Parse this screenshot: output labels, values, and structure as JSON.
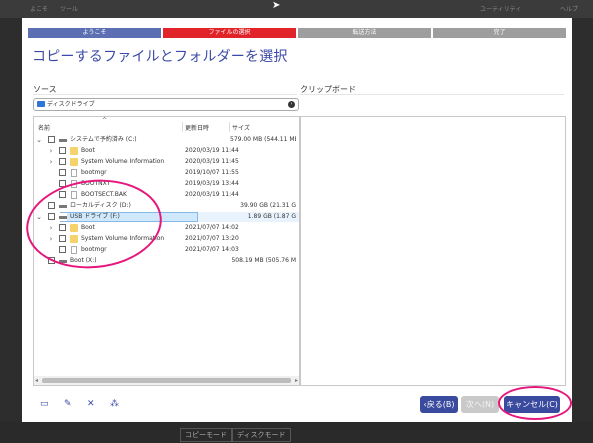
{
  "background": {
    "top_items": [
      "よこそ",
      "ツール",
      "ユーティリティ",
      "ヘルプ"
    ],
    "bottom_tabs": [
      "コピーモード",
      "ディスクモード"
    ]
  },
  "steps": [
    {
      "label": "ようこそ"
    },
    {
      "label": "ファイルの選択"
    },
    {
      "label": "転送方法"
    },
    {
      "label": "完了"
    }
  ],
  "title": "コピーするファイルとフォルダーを選択",
  "source": {
    "label": "ソース",
    "location": "ディスクドライブ"
  },
  "clipboard_label": "クリップボード",
  "tree": {
    "columns": {
      "name": "名前",
      "date": "更新日時",
      "size": "サイズ"
    },
    "rows": [
      {
        "name": "システムで予約済み (C:)",
        "date": "",
        "size": "579.00 MB (544.11 MB"
      },
      {
        "name": "Boot",
        "date": "2020/03/19 11:44",
        "size": ""
      },
      {
        "name": "System Volume Information",
        "date": "2020/03/19 11:45",
        "size": ""
      },
      {
        "name": "bootmgr",
        "date": "2019/10/07 11:55",
        "size": ""
      },
      {
        "name": "BOOTNXT",
        "date": "2019/03/19 13:44",
        "size": ""
      },
      {
        "name": "BOOTSECT.BAK",
        "date": "2020/03/19 11:44",
        "size": ""
      },
      {
        "name": "ローカルディスク (D:)",
        "date": "",
        "size": "39.90 GB (21.31 G"
      },
      {
        "name": "USB ドライブ (F:)",
        "date": "",
        "size": "1.89 GB (1.87 G"
      },
      {
        "name": "Boot",
        "date": "2021/07/07 14:02",
        "size": ""
      },
      {
        "name": "System Volume Information",
        "date": "2021/07/07 13:20",
        "size": ""
      },
      {
        "name": "bootmgr",
        "date": "2021/07/07 14:03",
        "size": ""
      },
      {
        "name": "Boot (X:)",
        "date": "",
        "size": "508.19 MB (505.76 M"
      }
    ]
  },
  "buttons": {
    "back": "‹戻る(B)",
    "next": "次へ(N)",
    "cancel": "キャンセル(C)"
  },
  "colors": {
    "accent": "#3a4a9e",
    "active_step": "#e0242a",
    "annotation": "#e5177d"
  }
}
